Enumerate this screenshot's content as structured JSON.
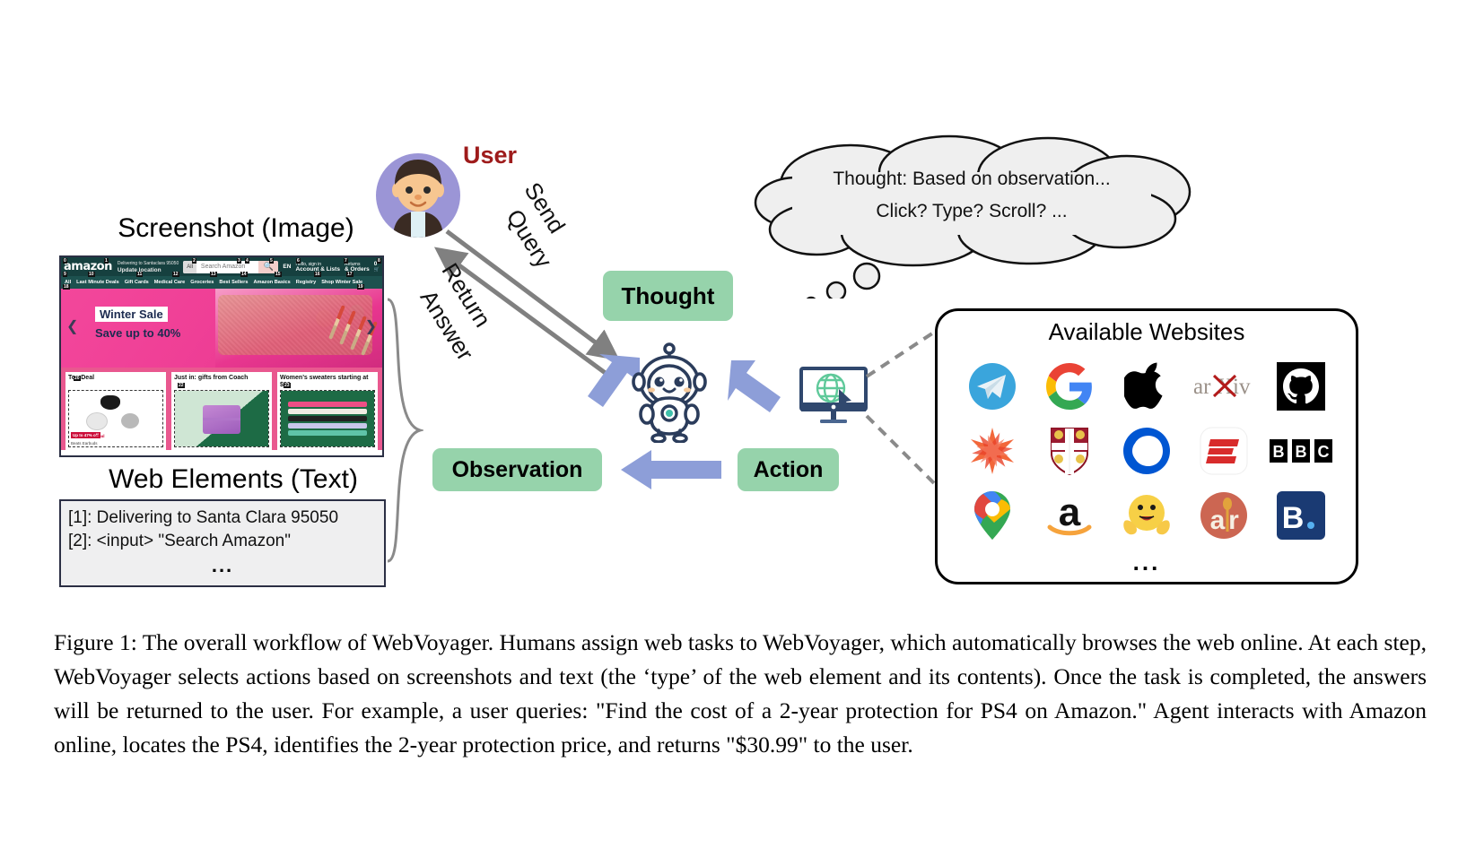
{
  "figure": {
    "screenshot_label": "Screenshot (Image)",
    "webelements_label": "Web Elements (Text)",
    "user_label": "User",
    "websites_title": "Available Websites",
    "websites_dots": "...",
    "caption": "Figure 1: The overall workflow of WebVoyager. Humans assign web tasks to WebVoyager, which automatically browses the web online. At each step, WebVoyager selects actions based on screenshots and text (the ‘type’ of the web element and its contents). Once the task is completed, the answers will be returned to the user. For example, a user queries: \"Find the cost of a 2-year protection for PS4 on Amazon.\" Agent interacts with Amazon online, locates the PS4, identifies the 2-year protection price, and returns \"$30.99\" to the user."
  },
  "colors": {
    "user_label": "#9e1b1b",
    "pill_green": "#96d3ab",
    "arrow_blue": "#8d9ed8",
    "arrow_gray": "#808080",
    "cloud_fill": "#efefef",
    "monitor_navy": "#30486e",
    "globe_green": "#5fc99a",
    "amazon_dark": "#16403f"
  },
  "amazon_screenshot": {
    "logo": "amazon",
    "deliver_small": "Delivering to Santaclara 95050",
    "deliver_bold": "Update location",
    "search_category": "All",
    "search_placeholder": "Search Amazon",
    "search_icon": "search-icon",
    "lang": "EN",
    "account_small": "Hello, sign in",
    "account_bold": "Account & Lists",
    "orders_small": "Returns",
    "orders_bold": "& Orders",
    "cart_count": "0",
    "nav_items": [
      "All",
      "Last Minute Deals",
      "Gift Cards",
      "Medical Care",
      "Groceries",
      "Best Sellers",
      "Amazon Basics",
      "Registry",
      "Shop Winter Sale"
    ],
    "hero_title": "Winter Sale",
    "hero_subtitle": "Save up to 40%",
    "cards": [
      {
        "title": "Top Deal",
        "badge": "Up to 47% off",
        "deal_word": "Deal",
        "caption": "Beats Earbuds"
      },
      {
        "title": "Just in: gifts from Coach",
        "badge": "",
        "deal_word": "",
        "caption": ""
      },
      {
        "title": "Women’s sweaters starting at $20",
        "badge": "",
        "deal_word": "",
        "caption": ""
      }
    ],
    "element_numbers": [
      "0",
      "1",
      "2",
      "3",
      "4",
      "5",
      "6",
      "7",
      "8",
      "9",
      "10",
      "11",
      "12",
      "13",
      "14",
      "15",
      "16",
      "17",
      "18",
      "19",
      "20",
      "21",
      "22",
      "23"
    ]
  },
  "web_elements": {
    "lines": [
      "[1]: Delivering to Santa Clara 95050",
      "[2]: <input> \"Search Amazon\""
    ],
    "dots": "..."
  },
  "arrows": {
    "send_query": [
      "Send",
      "Query"
    ],
    "return_answer": [
      "Return",
      "Answer"
    ]
  },
  "thought_cloud": {
    "line1": "Thought: Based on observation...",
    "line2": "Click? Type? Scroll? ..."
  },
  "pills": {
    "thought": "Thought",
    "observation": "Observation",
    "action": "Action"
  },
  "websites": [
    {
      "name": "telegram-icon",
      "label": "Telegram"
    },
    {
      "name": "google-icon",
      "label": "Google"
    },
    {
      "name": "apple-icon",
      "label": "Apple"
    },
    {
      "name": "arxiv-icon",
      "label": "arXiv"
    },
    {
      "name": "github-icon",
      "label": "GitHub"
    },
    {
      "name": "wolfram-alpha-icon",
      "label": "Wolfram Alpha"
    },
    {
      "name": "cambridge-dictionary-icon",
      "label": "Cambridge Dictionary"
    },
    {
      "name": "coursera-icon",
      "label": "Coursera"
    },
    {
      "name": "espn-icon",
      "label": "ESPN"
    },
    {
      "name": "bbc-icon",
      "label": "BBC"
    },
    {
      "name": "google-maps-icon",
      "label": "Google Maps"
    },
    {
      "name": "amazon-icon",
      "label": "Amazon"
    },
    {
      "name": "huggingface-icon",
      "label": "Hugging Face"
    },
    {
      "name": "allrecipes-icon",
      "label": "Allrecipes"
    },
    {
      "name": "booking-icon",
      "label": "Booking.com"
    }
  ]
}
